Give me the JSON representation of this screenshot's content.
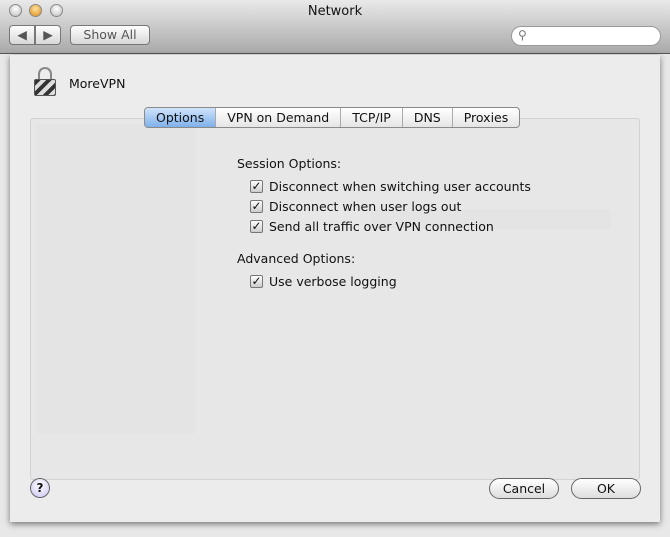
{
  "window": {
    "title": "Network"
  },
  "toolbar": {
    "back": "◀",
    "forward": "▶",
    "show_all": "Show All",
    "search_placeholder": "",
    "search_icon": "magnifier"
  },
  "sheet": {
    "service_name": "MoreVPN",
    "tabs": [
      {
        "label": "Options",
        "selected": true
      },
      {
        "label": "VPN on Demand"
      },
      {
        "label": "TCP/IP"
      },
      {
        "label": "DNS"
      },
      {
        "label": "Proxies"
      }
    ],
    "session_label": "Session Options:",
    "session_options": [
      {
        "label": "Disconnect when switching user accounts",
        "checked": true
      },
      {
        "label": "Disconnect when user logs out",
        "checked": true
      },
      {
        "label": "Send all traffic over VPN connection",
        "checked": true
      }
    ],
    "advanced_label": "Advanced Options:",
    "advanced_options": [
      {
        "label": "Use verbose logging",
        "checked": true
      }
    ],
    "help": "?",
    "cancel": "Cancel",
    "ok": "OK"
  },
  "colors": {
    "selected_tab": "#7fb0ea"
  }
}
